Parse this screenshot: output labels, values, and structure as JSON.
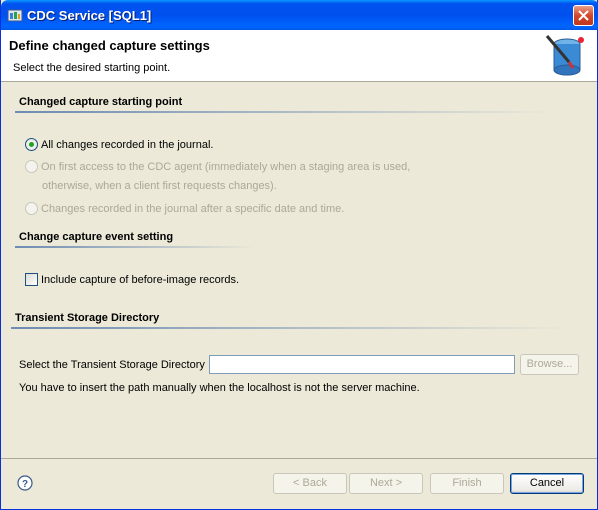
{
  "window": {
    "title": "CDC Service [SQL1]"
  },
  "header": {
    "title": "Define changed capture settings",
    "subtitle": "Select the desired starting point."
  },
  "starting_point": {
    "section_title": "Changed capture starting point",
    "options": [
      {
        "label": "All changes recorded in the journal.",
        "selected": true,
        "enabled": true
      },
      {
        "label_line1": "On first access to the CDC agent (immediately when a staging area is used,",
        "label_line2": "otherwise, when a client first requests changes).",
        "selected": false,
        "enabled": false
      },
      {
        "label": "Changes recorded in the journal after a specific date and time.",
        "selected": false,
        "enabled": false
      }
    ]
  },
  "event_setting": {
    "section_title": "Change capture event setting",
    "checkbox_label": "Include capture of before-image records.",
    "checked": false
  },
  "transient": {
    "section_title": "Transient Storage Directory",
    "field_label": "Select the Transient Storage Directory",
    "field_value": "",
    "browse_label": "Browse...",
    "note": "You have to insert the path manually when the localhost is not the server machine."
  },
  "buttons": {
    "back": "< Back",
    "next": "Next >",
    "finish": "Finish",
    "cancel": "Cancel"
  }
}
